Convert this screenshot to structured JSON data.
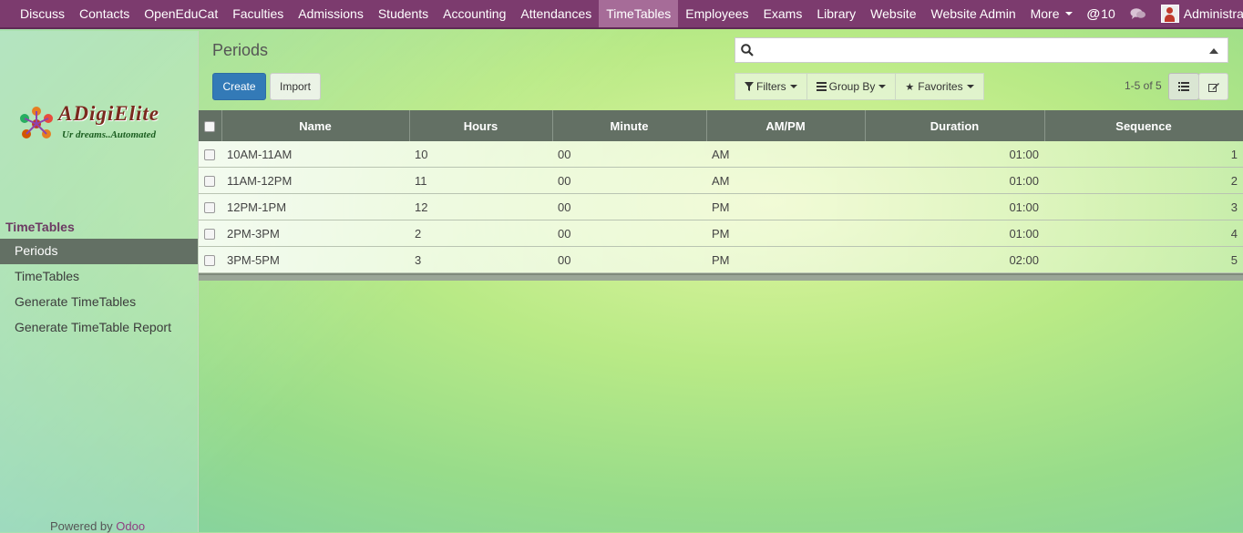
{
  "navbar": {
    "menu": [
      "Discuss",
      "Contacts",
      "OpenEduCat",
      "Faculties",
      "Admissions",
      "Students",
      "Accounting",
      "Attendances",
      "TimeTables",
      "Employees",
      "Exams",
      "Library",
      "Website",
      "Website Admin"
    ],
    "more_label": "More",
    "active": "TimeTables",
    "mentions_count": "10",
    "user_name": "Administrator"
  },
  "sidebar": {
    "logo_title": "ADigiElite",
    "logo_tagline": "Ur dreams..Automated",
    "section_title": "TimeTables",
    "items": [
      {
        "label": "Periods",
        "active": true
      },
      {
        "label": "TimeTables",
        "active": false
      },
      {
        "label": "Generate TimeTables",
        "active": false
      },
      {
        "label": "Generate TimeTable Report",
        "active": false
      }
    ],
    "powered_by": "Powered by",
    "powered_brand": "Odoo"
  },
  "control_panel": {
    "title": "Periods",
    "create_label": "Create",
    "import_label": "Import",
    "search_value": "",
    "filters_label": "Filters",
    "group_by_label": "Group By",
    "favorites_label": "Favorites",
    "pager": "1-5 of 5"
  },
  "table": {
    "headers": [
      "Name",
      "Hours",
      "Minute",
      "AM/PM",
      "Duration",
      "Sequence"
    ],
    "rows": [
      {
        "name": "10AM-11AM",
        "hours": "10",
        "minute": "00",
        "ampm": "AM",
        "duration": "01:00",
        "sequence": "1"
      },
      {
        "name": "11AM-12PM",
        "hours": "11",
        "minute": "00",
        "ampm": "AM",
        "duration": "01:00",
        "sequence": "2"
      },
      {
        "name": "12PM-1PM",
        "hours": "12",
        "minute": "00",
        "ampm": "PM",
        "duration": "01:00",
        "sequence": "3"
      },
      {
        "name": "2PM-3PM",
        "hours": "2",
        "minute": "00",
        "ampm": "PM",
        "duration": "01:00",
        "sequence": "4"
      },
      {
        "name": "3PM-5PM",
        "hours": "3",
        "minute": "00",
        "ampm": "PM",
        "duration": "02:00",
        "sequence": "5"
      }
    ]
  },
  "colors": {
    "navbar": "#7c3b6e",
    "navbar_active": "#a66c98",
    "primary_button": "#337ab7",
    "table_header": "#637064"
  }
}
